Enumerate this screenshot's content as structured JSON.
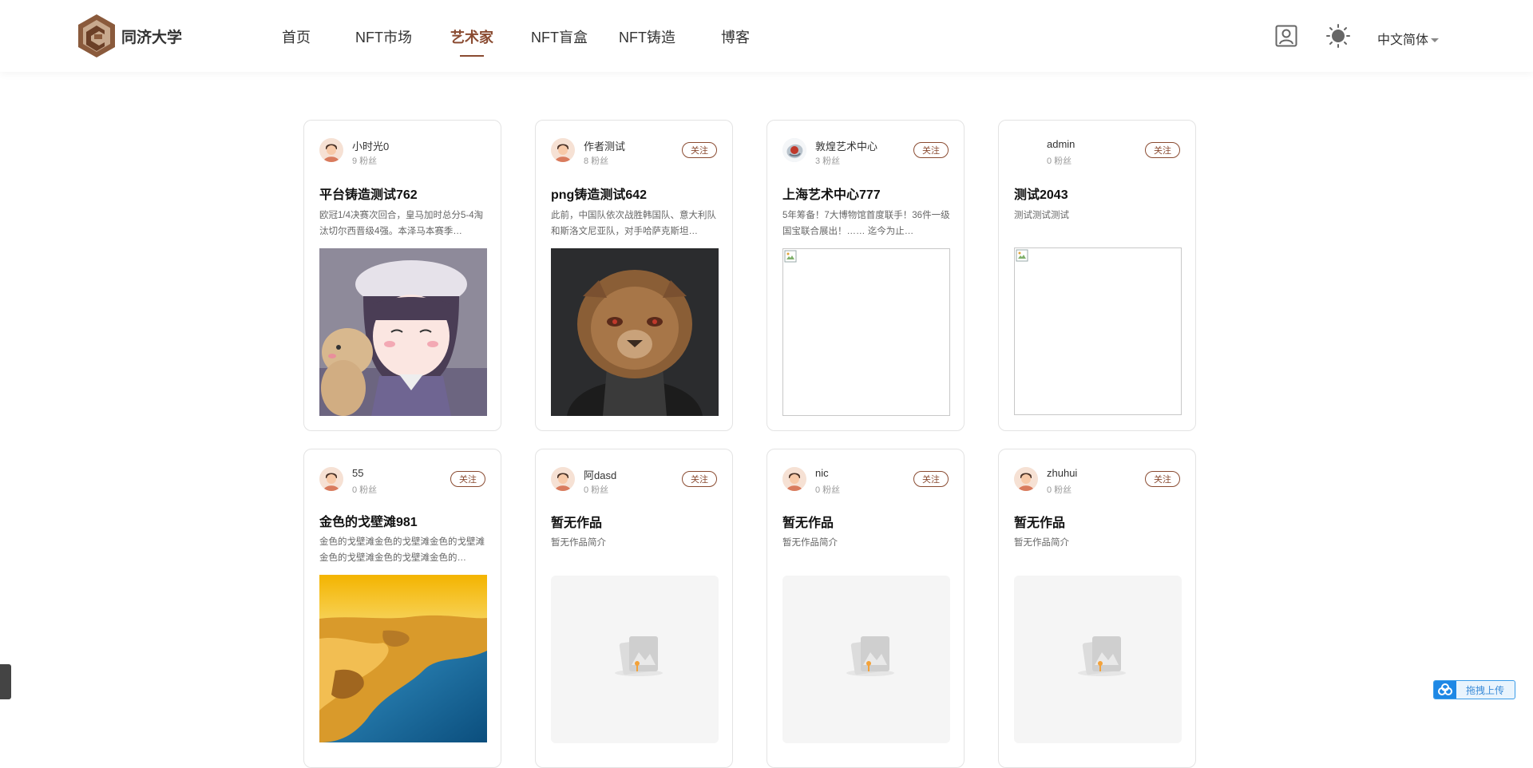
{
  "brand": {
    "name": "同济大学"
  },
  "nav": {
    "items": [
      {
        "label": "首页"
      },
      {
        "label": "NFT市场"
      },
      {
        "label": "艺术家"
      },
      {
        "label": "NFT盲盒"
      },
      {
        "label": "NFT铸造"
      },
      {
        "label": "博客"
      }
    ],
    "active_index": 2
  },
  "header": {
    "language": "中文简体",
    "icons": [
      "user-profile-icon",
      "sun-icon"
    ]
  },
  "colors": {
    "accent": "#8a4b31",
    "upload": "#1e88e5"
  },
  "artists": [
    {
      "name": "小时光0",
      "fans": "9 粉丝",
      "follow": "",
      "work_title": "平台铸造测试762",
      "desc": "欧冠1/4决赛次回合，皇马加时总分5-4淘汰切尔西晋级4强。本泽马本赛季…",
      "image": "anime-girl-image"
    },
    {
      "name": "作者测试",
      "fans": "8 粉丝",
      "follow": "关注",
      "work_title": "png铸造测试642",
      "desc": "此前，中国队依次战胜韩国队、意大利队和斯洛文尼亚队，对手哈萨克斯坦…",
      "image": "lion-portrait-image"
    },
    {
      "name": "敦煌艺术中心",
      "fans": "3 粉丝",
      "follow": "关注",
      "work_title": "上海艺术中心777",
      "desc": "5年筹备！7大博物馆首度联手！36件一级国宝联合展出！…… 迄今为止…",
      "image": "broken-image"
    },
    {
      "name": "admin",
      "fans": "0 粉丝",
      "follow": "关注",
      "work_title": "测试2043",
      "desc": "测试测试测试",
      "image": "broken-image"
    },
    {
      "name": "55",
      "fans": "0 粉丝",
      "follow": "关注",
      "work_title": "金色的戈壁滩981",
      "desc": "金色的戈壁滩金色的戈壁滩金色的戈壁滩金色的戈壁滩金色的戈壁滩金色的…",
      "image": "golden-desert-image"
    },
    {
      "name": "阿dasd",
      "fans": "0 粉丝",
      "follow": "关注",
      "work_title": "暂无作品",
      "desc": "暂无作品简介",
      "image": "empty-placeholder"
    },
    {
      "name": "nic",
      "fans": "0 粉丝",
      "follow": "关注",
      "work_title": "暂无作品",
      "desc": "暂无作品简介",
      "image": "empty-placeholder"
    },
    {
      "name": "zhuhui",
      "fans": "0 粉丝",
      "follow": "关注",
      "work_title": "暂无作品",
      "desc": "暂无作品简介",
      "image": "empty-placeholder"
    }
  ],
  "upload": {
    "label": "拖拽上传"
  }
}
